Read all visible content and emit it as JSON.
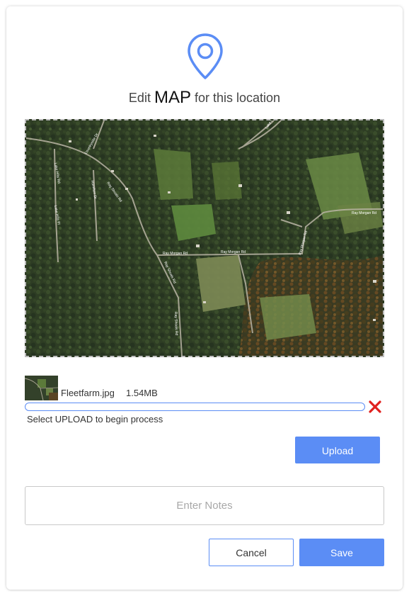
{
  "header": {
    "title_prefix": "Edit",
    "title_emphasis": "MAP",
    "title_suffix": "for this location",
    "icon": "location-pin-icon"
  },
  "map": {
    "roads": [
      "Countryside Dr",
      "Lake Hills Rd",
      "Hamilton Dr",
      "Ray Shoals Rd",
      "Lake Hills Pl",
      "Ray Morgan Rd",
      "Ray Morgan Rd",
      "Ray Morgan Rd",
      "Ray Morgan Rd",
      "Ray Shoals Rd",
      "Ray Shoals Rd",
      "Lake Dr",
      "Ray Morgan Rd"
    ]
  },
  "file": {
    "name": "Fleetfarm.jpg",
    "size": "1.54MB",
    "progress": 0,
    "status": "Select UPLOAD to begin process",
    "remove_icon": "close-x-icon"
  },
  "actions": {
    "upload_label": "Upload",
    "notes_placeholder": "Enter Notes",
    "notes_value": "",
    "cancel_label": "Cancel",
    "save_label": "Save"
  },
  "colors": {
    "accent": "#5b8df5",
    "remove": "#e0201e",
    "border": "#c9c9c9"
  }
}
